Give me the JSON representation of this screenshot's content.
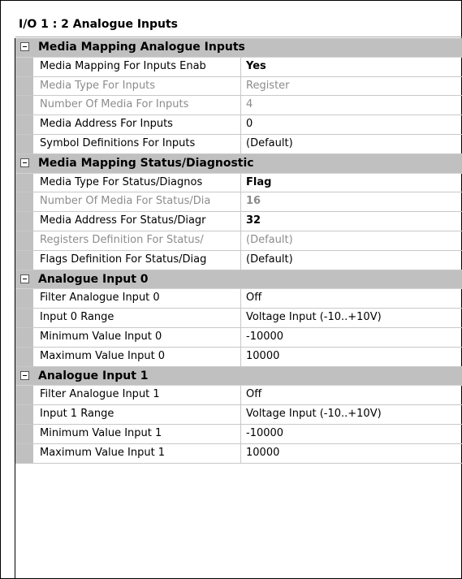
{
  "title": "I/O 1 : 2 Analogue Inputs",
  "categories": [
    {
      "label": "Media Mapping Analogue Inputs",
      "rows": [
        {
          "name": "Media Mapping For Inputs Enab",
          "value": "Yes",
          "bold": true,
          "readonly": false
        },
        {
          "name": "Media Type For Inputs",
          "value": "Register",
          "bold": false,
          "readonly": true
        },
        {
          "name": "Number Of Media For Inputs",
          "value": "4",
          "bold": false,
          "readonly": true
        },
        {
          "name": "Media Address For Inputs",
          "value": "0",
          "bold": false,
          "readonly": false
        },
        {
          "name": "Symbol Definitions For Inputs",
          "value": "(Default)",
          "bold": false,
          "readonly": false
        }
      ]
    },
    {
      "label": "Media Mapping Status/Diagnostic",
      "rows": [
        {
          "name": "Media Type For Status/Diagnos",
          "value": "Flag",
          "bold": true,
          "readonly": false
        },
        {
          "name": "Number Of Media For Status/Dia",
          "value": "16",
          "bold": true,
          "readonly": true
        },
        {
          "name": "Media Address For Status/Diagr",
          "value": "32",
          "bold": true,
          "readonly": false
        },
        {
          "name": "Registers Definition For Status/",
          "value": "(Default)",
          "bold": false,
          "readonly": true
        },
        {
          "name": "Flags Definition For Status/Diag",
          "value": "(Default)",
          "bold": false,
          "readonly": false
        }
      ]
    },
    {
      "label": "Analogue Input 0",
      "rows": [
        {
          "name": "Filter Analogue Input 0",
          "value": "Off",
          "bold": false,
          "readonly": false
        },
        {
          "name": "Input 0 Range",
          "value": "Voltage Input (-10..+10V)",
          "bold": false,
          "readonly": false
        },
        {
          "name": "Minimum Value Input 0",
          "value": "-10000",
          "bold": false,
          "readonly": false
        },
        {
          "name": "Maximum Value Input 0",
          "value": "10000",
          "bold": false,
          "readonly": false
        }
      ]
    },
    {
      "label": "Analogue Input 1",
      "rows": [
        {
          "name": "Filter Analogue Input 1",
          "value": "Off",
          "bold": false,
          "readonly": false
        },
        {
          "name": "Input 1 Range",
          "value": "Voltage Input (-10..+10V)",
          "bold": false,
          "readonly": false
        },
        {
          "name": "Minimum Value Input 1",
          "value": "-10000",
          "bold": false,
          "readonly": false
        },
        {
          "name": "Maximum Value Input 1",
          "value": "10000",
          "bold": false,
          "readonly": false
        }
      ]
    }
  ]
}
